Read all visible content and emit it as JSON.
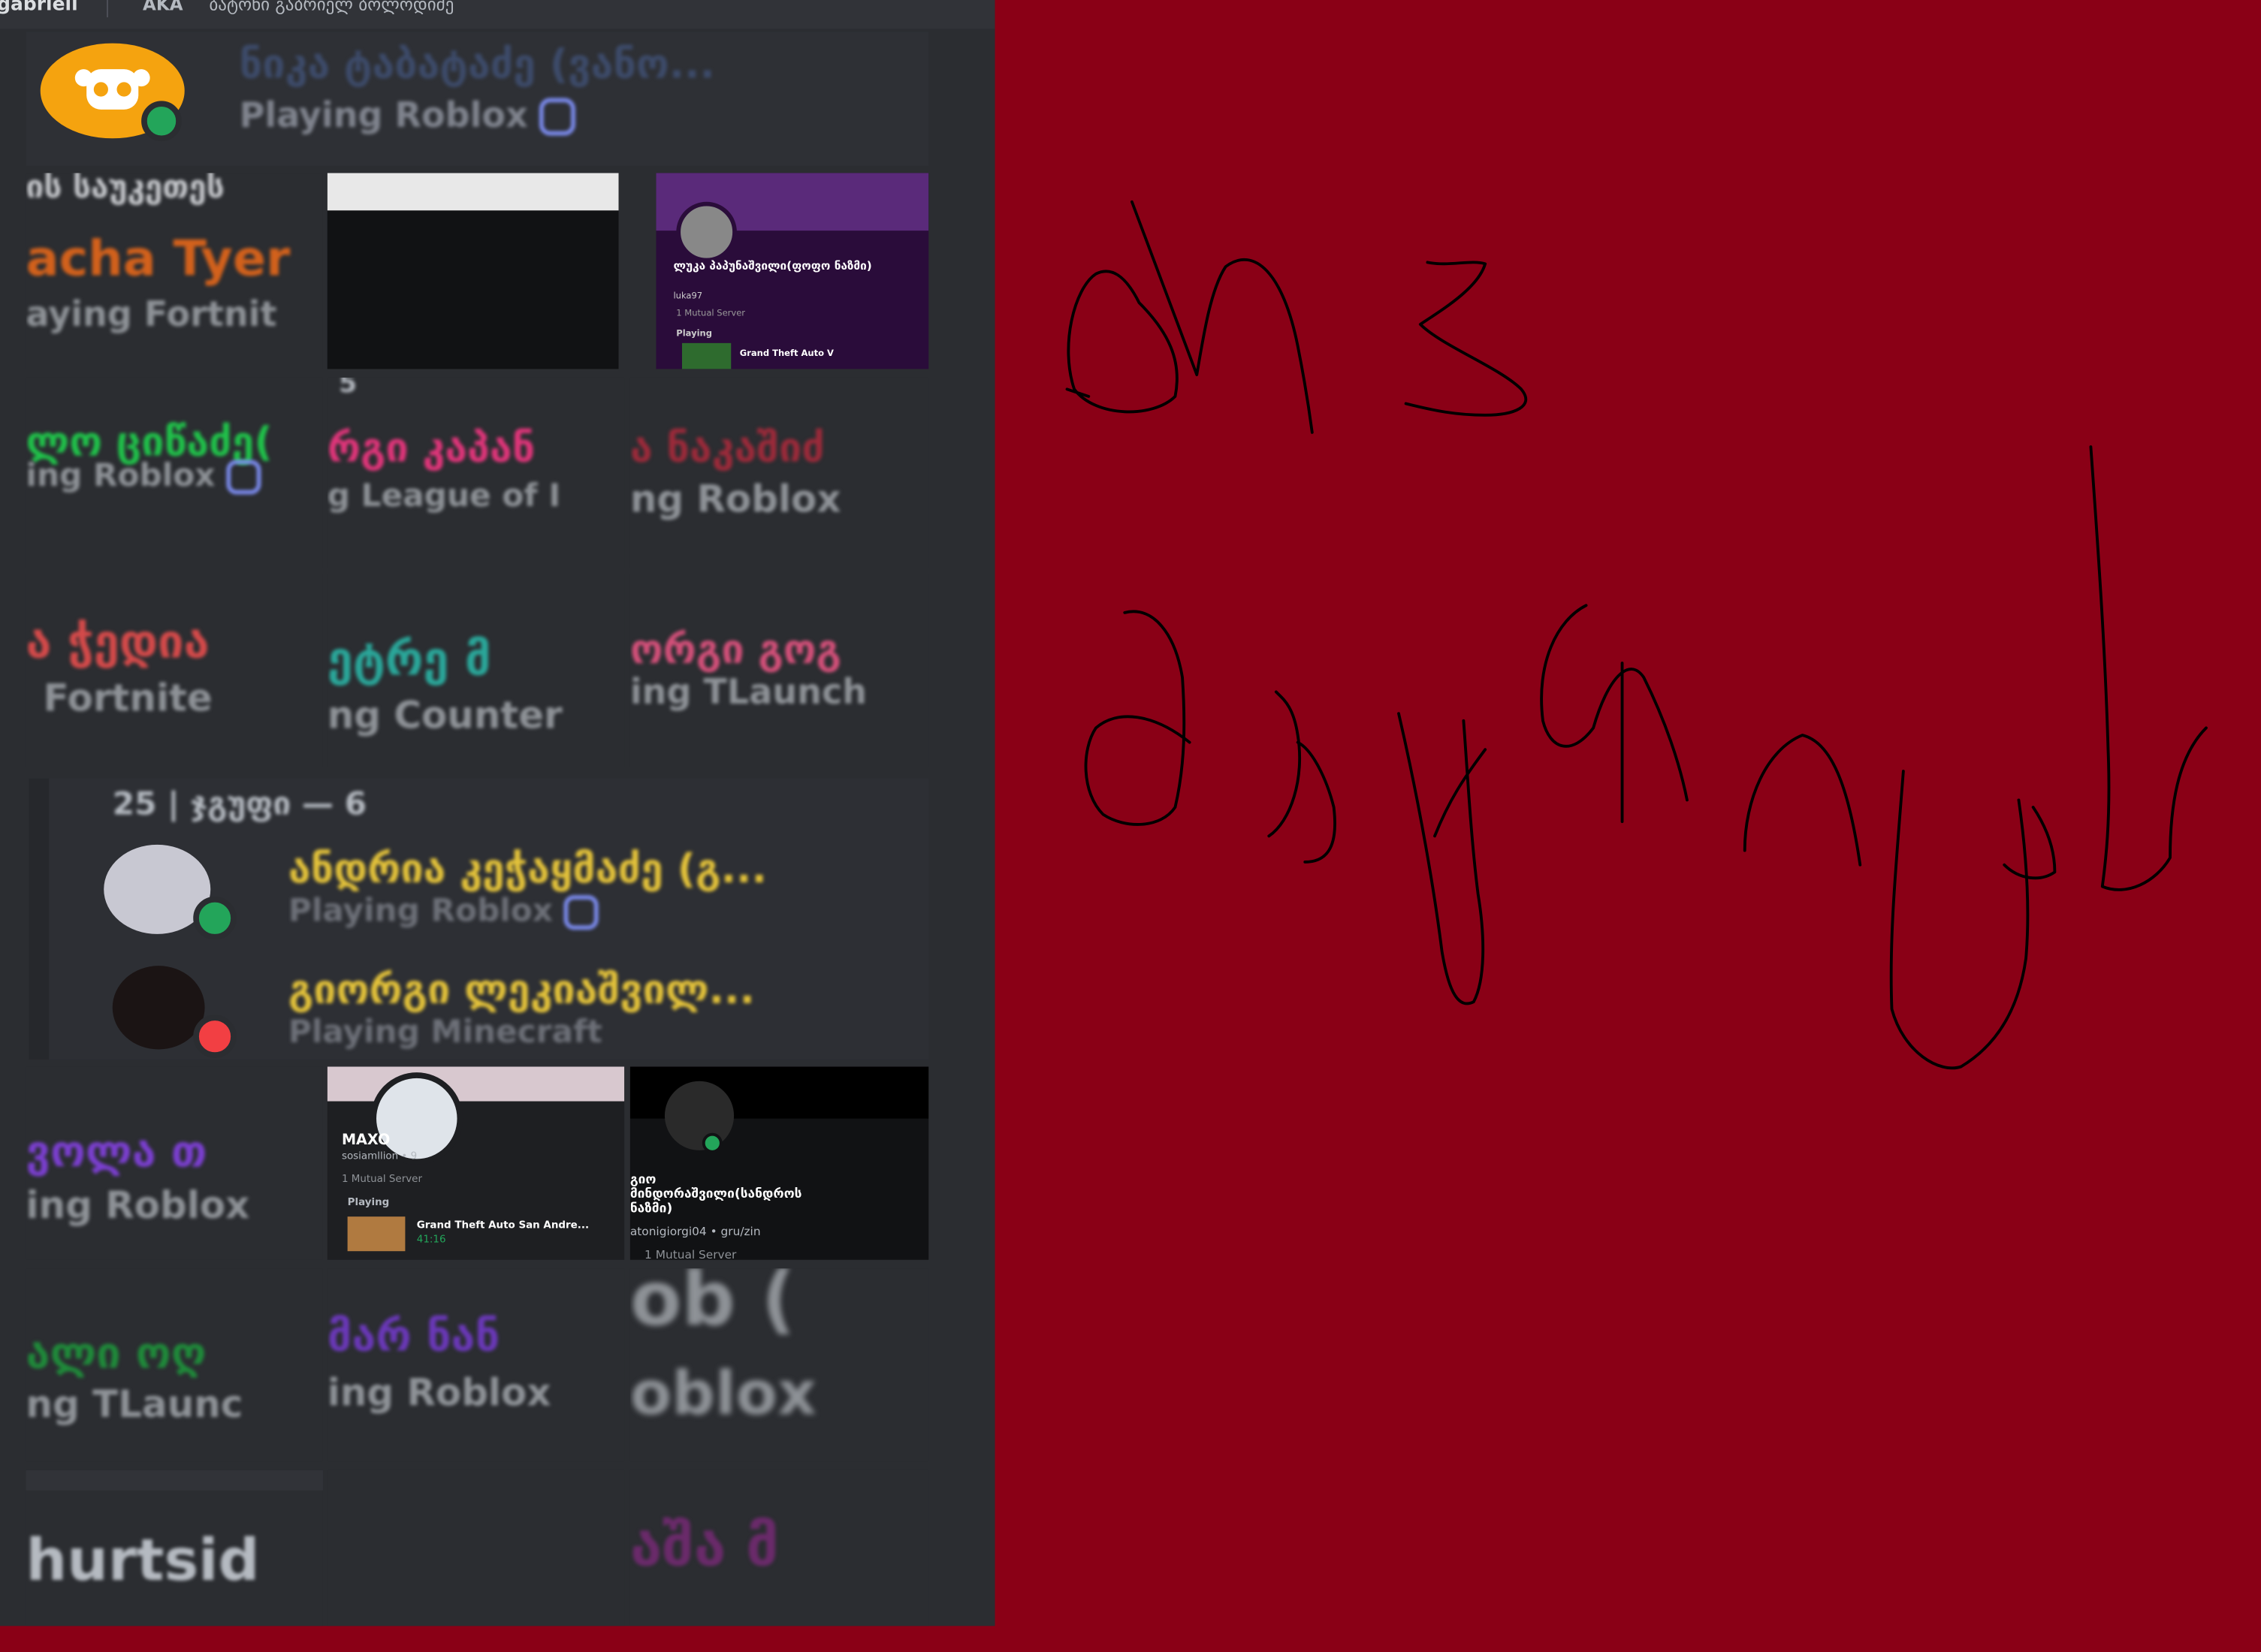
{
  "profile_header": {
    "username": "gabrieli",
    "aka_label": "AKA",
    "alias": "ბატონი გაბრიელ ბოლოდიძე"
  },
  "top_card": {
    "name": "ნიკა ტაბატაძე (ვანო...",
    "activity": "Playing Roblox"
  },
  "fragments": [
    {
      "name": "ის საუკეთეს",
      "color": "#d9d9d9"
    },
    {
      "name": "acha Tyer",
      "activity": "aying Fortnit",
      "color": "#d2611c"
    },
    {
      "name": "ლო ციწაძე(",
      "activity": "ing Roblox",
      "color": "#20c24a"
    },
    {
      "name": "რგი კაპან",
      "activity": "g League of I",
      "color": "#e0357a"
    },
    {
      "name": "ა ნაკაშიძ",
      "activity": "ng Roblox",
      "color": "#9c2a3a"
    },
    {
      "name": "ა ჭედია",
      "activity": "Fortnite",
      "color": "#d44a4a"
    },
    {
      "name": "ეტრე მ",
      "activity": "ng Counter",
      "color": "#2aa79a"
    },
    {
      "name": "ორგი გოგ",
      "activity": "ing TLaunch",
      "color": "#d4507a"
    },
    {
      "name": "ვოლა თ",
      "activity": "ing Roblox",
      "color": "#7b3fd0"
    },
    {
      "name": "ალი ოღ",
      "activity": "ng TLaunc",
      "color": "#1f8a3a"
    },
    {
      "name": "მარ ნან",
      "activity": "ing Roblox",
      "color": "#6a38b8"
    },
    {
      "name": "ob (",
      "activity": "oblox",
      "color": "#8e9297"
    },
    {
      "name": "hurtsid",
      "color": "#b5bac1"
    },
    {
      "name": "აშა მ",
      "color": "#6a2a6a"
    }
  ],
  "group_card": {
    "header": "25 | ჯგუფი — 6",
    "members": [
      {
        "name": "ანდრია კეჭაყმაძე (გ...",
        "activity": "Playing Roblox",
        "color": "#e3c23a"
      },
      {
        "name": "გიორგი ლეკიაშვილ...",
        "activity": "Playing Minecraft",
        "color": "#e3c23a"
      }
    ]
  },
  "mini_profiles": [
    {
      "name": "ლუკა პაპუნაშვილი(ფოფო ნაზმი)",
      "sub": "luka97",
      "mutual": "1 Mutual Server",
      "section": "Playing",
      "game": "Grand Theft Auto V"
    },
    {
      "name": "MAXO",
      "sub": "sosiamllion • 9",
      "mutual": "1 Mutual Server",
      "section": "Playing",
      "game": "Grand Theft Auto San Andre...",
      "time": "41:16"
    },
    {
      "name": "გიო\nმინდორაშვილი(სანდროს\nნაზმი)",
      "sub": "atonigiorgi04 • gru/zin",
      "mutual": "1 Mutual Server"
    }
  ],
  "misc": {
    "number_label": "5"
  },
  "colors": {
    "background": "#8a0016",
    "panel": "#2b2d31",
    "online": "#23a55a",
    "dnd": "#f23f43"
  }
}
